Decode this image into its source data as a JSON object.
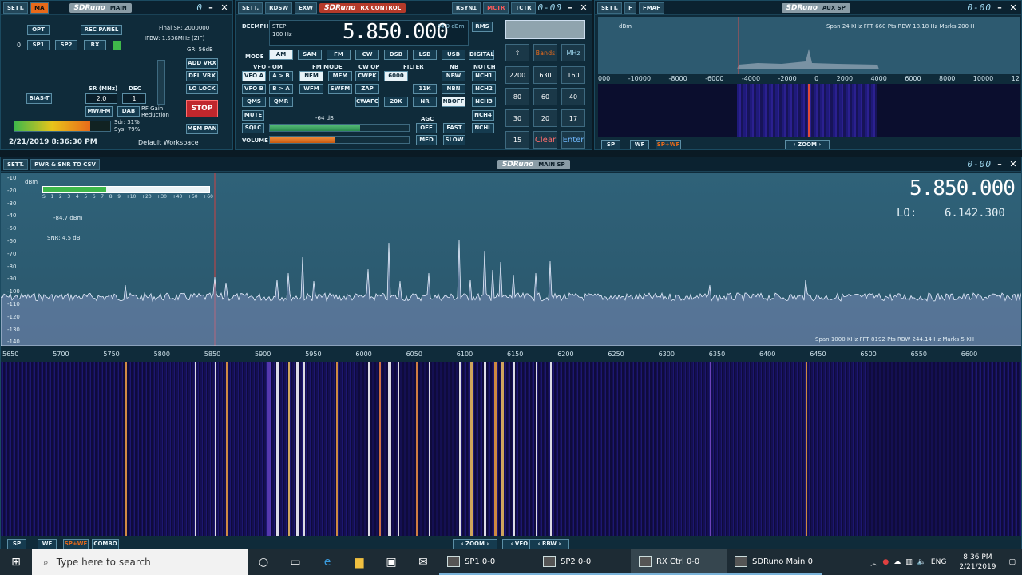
{
  "main": {
    "settings_label": "SETT.",
    "ma_label": "MA",
    "logo": "SDRuno",
    "title": "MAIN",
    "opt_label": "OPT",
    "rec_panel_label": "REC PANEL",
    "final_sr": "Final SR: 2000000",
    "ifbw": "IFBW: 1.536MHz (ZIF)",
    "gr": "GR: 56dB",
    "zero": "0",
    "sp1_label": "SP1",
    "sp2_label": "SP2",
    "rx_label": "RX",
    "add_vrx_label": "ADD VRX",
    "del_vrx_label": "DEL VRX",
    "lo_lock_label": "LO LOCK",
    "bias_t_label": "BIAS-T",
    "sr_label": "SR (MHz)",
    "sr_value": "2.0",
    "dec_label": "DEC",
    "dec_value": "1",
    "rf_gain_label": "RF Gain Reduction",
    "mwfm_label": "MW/FM",
    "dab_label": "DAB",
    "stop_label": "STOP",
    "sdr_cpu": "Sdr: 31%",
    "sys_cpu": "Sys: 79%",
    "mem_pan_label": "MEM PAN",
    "datetime": "2/21/2019 8:36:30 PM",
    "workspace": "Default Workspace",
    "cpu_fill": 0.79
  },
  "rx": {
    "settings_label": "SETT.",
    "rdsw_label": "RDSW",
    "exw_label": "EXW",
    "logo": "SDRuno",
    "title": "RX CONTROL",
    "rsyn_label": "RSYN1",
    "mctr_label": "MCTR",
    "tctr_label": "TCTR",
    "lcd": "0-00",
    "deemph": "DEEMPH",
    "step": "STEP:",
    "step_value": "100 Hz",
    "freq": "5.850.000",
    "dbm": "-84.9 dBm",
    "rms_label": "RMS",
    "mode_label": "MODE",
    "modes": [
      "AM",
      "SAM",
      "FM",
      "CW",
      "DSB",
      "LSB",
      "USB",
      "DIGITAL"
    ],
    "vfo_qm": "VFO - QM",
    "fm_mode": "FM MODE",
    "cw_op": "CW OP",
    "filter": "FILTER",
    "nb": "NB",
    "notch": "NOTCH",
    "row1": [
      "VFO A",
      "A > B",
      "NFM",
      "MFM",
      "CWPK",
      "6000",
      "NBW",
      "NCH1"
    ],
    "row2": [
      "VFO B",
      "B > A",
      "WFM",
      "SWFM",
      "ZAP",
      "11K",
      "NBN",
      "NCH2"
    ],
    "row3": [
      "QMS",
      "QMR",
      "CWAFC",
      "20K",
      "NR",
      "NBOFF",
      "NCH3"
    ],
    "agc_label": "AGC",
    "mute_label": "MUTE",
    "signal_db": "-64 dB",
    "nch4": "NCH4",
    "sqlc_label": "SQLC",
    "agc_off": "OFF",
    "agc_fast": "FAST",
    "nchl": "NCHL",
    "volume_label": "VOLUME",
    "agc_med": "MED",
    "agc_slow": "SLOW",
    "sql_fill": 0.65,
    "vol_fill": 0.47,
    "keypad": {
      "top_label": "Bands",
      "mhz_label": "MHz",
      "keys": [
        "2200",
        "630",
        "160",
        "80",
        "60",
        "40",
        "30",
        "20",
        "17",
        "15"
      ],
      "clear_label": "Clear",
      "enter_label": "Enter"
    }
  },
  "aux": {
    "settings_label": "SETT.",
    "f_label": "F",
    "fmaf_label": "FMAF",
    "logo": "SDRuno",
    "title": "AUX SP",
    "lcd": "0-00",
    "info": "Span 24 KHz  FFT 660 Pts  RBW 18.18 Hz  Marks 200 H",
    "dbm_unit": "dBm",
    "axis": [
      "000",
      "-10000",
      "-8000",
      "-6000",
      "-4000",
      "-2000",
      "0",
      "2000",
      "4000",
      "6000",
      "8000",
      "10000",
      "12"
    ],
    "sp_label": "SP",
    "wf_label": "WF",
    "spwf_label": "SP+WF",
    "zoom_label": "ZOOM"
  },
  "mainsp": {
    "settings_label": "SETT.",
    "csv_label": "PWR & SNR TO CSV",
    "logo": "SDRuno",
    "title": "MAIN SP",
    "lcd": "0-00",
    "dbm_unit": "dBm",
    "yticks": [
      "-10",
      "-20",
      "-30",
      "-40",
      "-50",
      "-60",
      "-70",
      "-80",
      "-90",
      "-100",
      "-110",
      "-120",
      "-130",
      "-140"
    ],
    "smeter_scale": [
      "S",
      "1",
      "2",
      "3",
      "4",
      "5",
      "6",
      "7",
      "8",
      "9",
      "+10",
      "+20",
      "+30",
      "+40",
      "+50",
      "+60"
    ],
    "signal_dbm": "-84.7 dBm",
    "snr": "SNR: 4.5 dB",
    "freq": "5.850.000",
    "lo_label": "LO:",
    "lo_value": "6.142.300",
    "info": "Span 1000 KHz  FFT 8192 Pts  RBW 244.14 Hz  Marks 5 KH",
    "xticks": [
      "5650",
      "5700",
      "5750",
      "5800",
      "5850",
      "5900",
      "5950",
      "6000",
      "6050",
      "6100",
      "6150",
      "6200",
      "6250",
      "6300",
      "6350",
      "6400",
      "6450",
      "6500",
      "6550",
      "6600"
    ],
    "sp_label": "SP",
    "wf_label": "WF",
    "spwf_label": "SP+WF",
    "combo_label": "COMBO",
    "zoom_label": "ZOOM",
    "vfo_label": "VFO",
    "rbw_label": "RBW"
  },
  "taskbar": {
    "search_placeholder": "Type here to search",
    "apps": [
      "SP1 0-0",
      "SP2 0-0",
      "RX Ctrl 0-0",
      "SDRuno Main 0"
    ],
    "lang": "ENG",
    "time": "8:36 PM",
    "date": "2/21/2019"
  },
  "colors": {
    "accent": "#e86a1a",
    "panel": "#0f2b3a",
    "spectrum": "#2d5a70",
    "green": "#3fb84a"
  }
}
